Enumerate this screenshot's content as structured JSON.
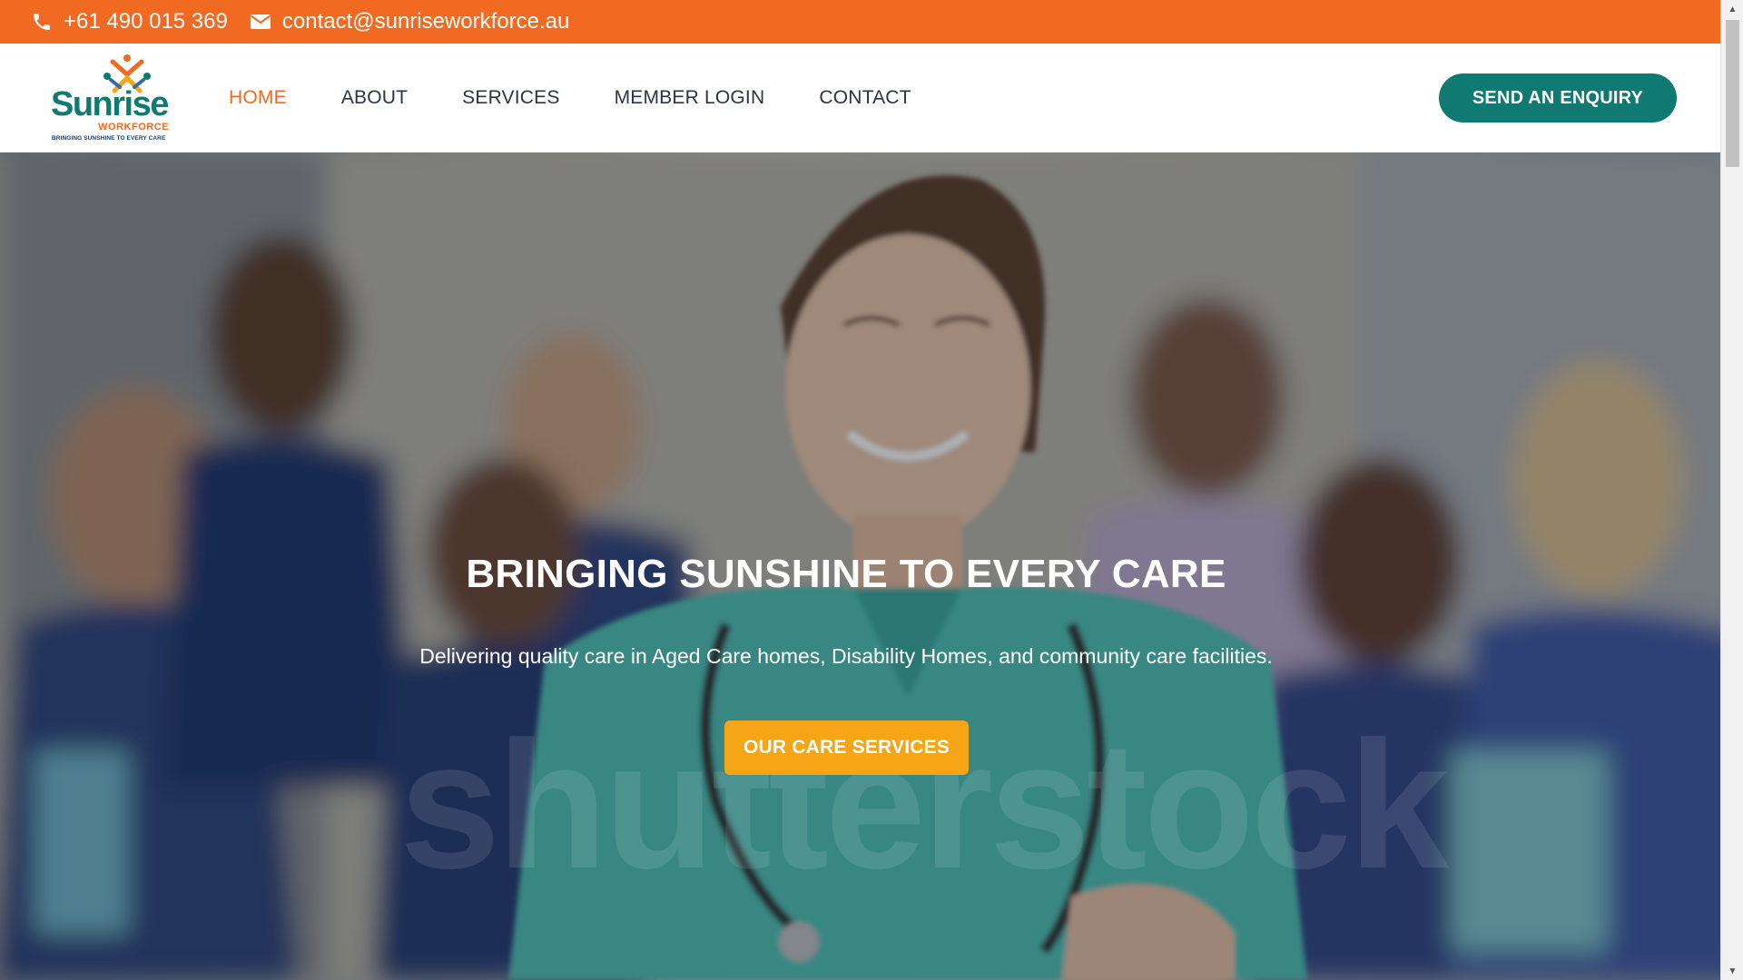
{
  "topbar": {
    "phone": "+61 490 015 369",
    "email": "contact@sunriseworkforce.au",
    "phone_icon": "phone-icon",
    "email_icon": "envelope-icon",
    "background": "#f26a21"
  },
  "logo": {
    "word": "Sunrise",
    "sub": "WORKFORCE",
    "tagline": "BRINGING SUNSHINE TO EVERY CARE"
  },
  "nav": {
    "items": [
      {
        "label": "HOME",
        "active": true
      },
      {
        "label": "ABOUT",
        "active": false
      },
      {
        "label": "SERVICES",
        "active": false
      },
      {
        "label": "MEMBER LOGIN",
        "active": false
      },
      {
        "label": "CONTACT",
        "active": false
      }
    ],
    "enquiry_label": "SEND AN ENQUIRY"
  },
  "hero": {
    "title": "BRINGING SUNSHINE TO EVERY CARE",
    "subtitle": "Delivering quality care in Aged Care homes, Disability Homes, and community care facilities.",
    "cta_label": "OUR CARE SERVICES",
    "watermark": "shutterstock"
  },
  "colors": {
    "accent_orange": "#f26a21",
    "brand_teal": "#0f7a72",
    "cta_yellow": "#f5a516",
    "nav_text": "#2b3440"
  }
}
